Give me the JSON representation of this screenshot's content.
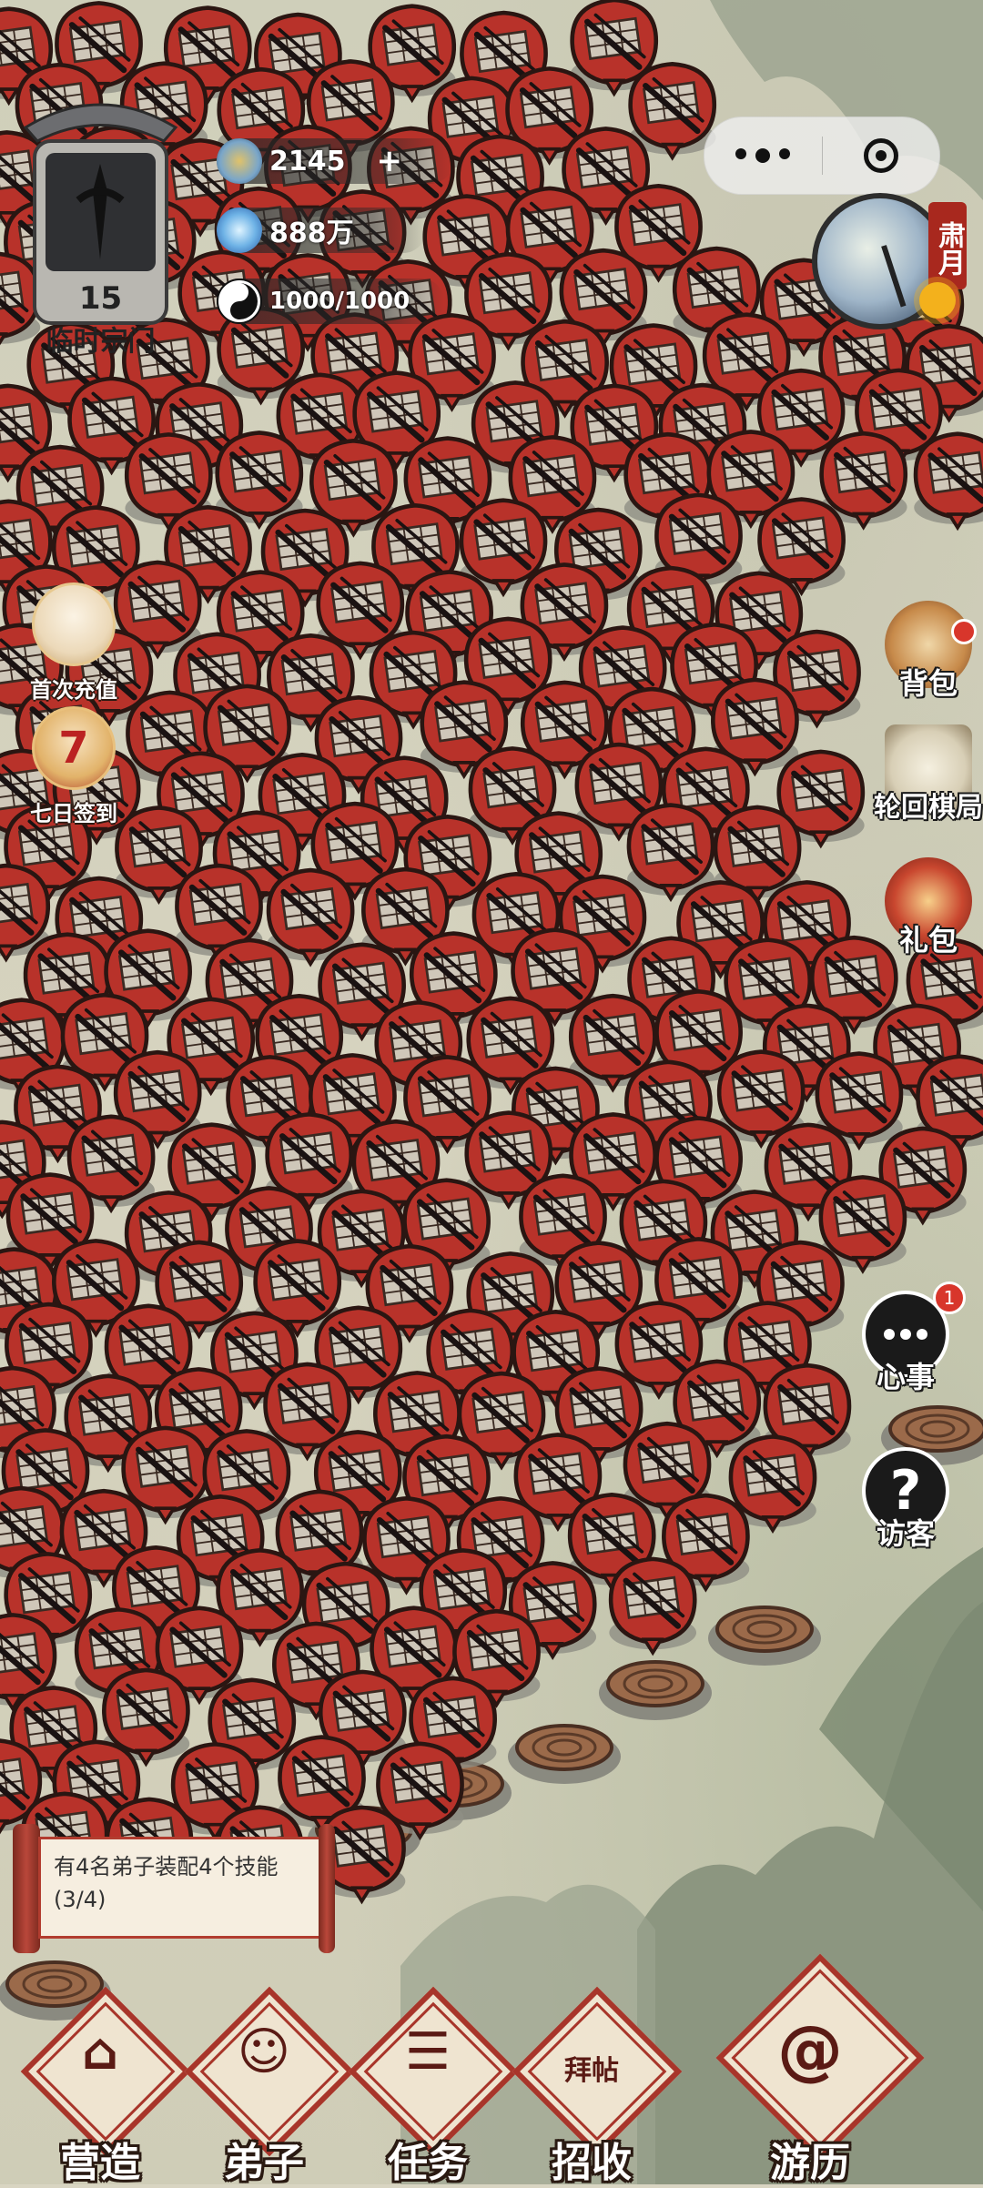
{
  "sect": {
    "level": "15",
    "name": "临时宗门"
  },
  "resources": {
    "spirit": {
      "value": "2145",
      "plus": "+"
    },
    "crystal": {
      "value": "888万"
    },
    "yinyang": {
      "value": "1000/1000"
    }
  },
  "season": {
    "label": "肃月"
  },
  "left_events": [
    {
      "label": "首次充值"
    },
    {
      "label": "七日签到",
      "glyph": "7"
    }
  ],
  "right_menu": {
    "bag": "背包",
    "chess": "轮回棋局",
    "gift": "礼包",
    "worry": "心事",
    "worry_badge": "1",
    "visitor": "访客"
  },
  "quest": {
    "text": "有4名弟子装配4个技能(3/4)"
  },
  "nav": [
    {
      "label": "营造",
      "glyph": "⌂"
    },
    {
      "label": "弟子",
      "glyph": "☺"
    },
    {
      "label": "任务",
      "glyph": "☰"
    },
    {
      "label": "招收",
      "glyph": "拜帖"
    },
    {
      "label": "游历",
      "glyph": "@"
    }
  ],
  "colors": {
    "marker_red": "#b8322a",
    "nav_red": "#a8352a",
    "parchment": "#efe4d0"
  }
}
